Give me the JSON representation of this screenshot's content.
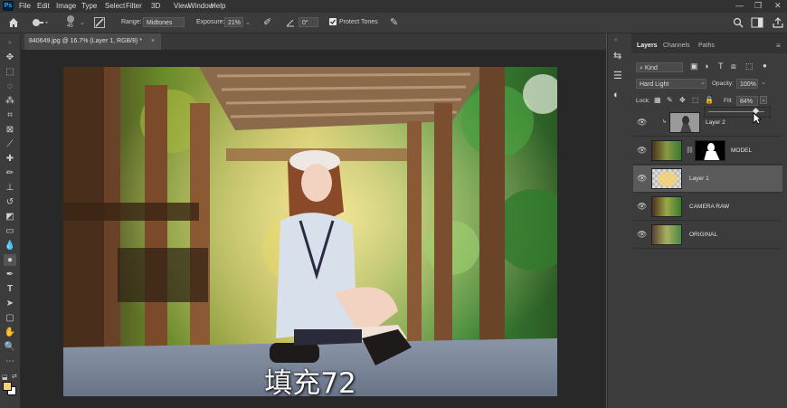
{
  "menubar": {
    "logo": "Ps",
    "items": [
      "File",
      "Edit",
      "Image",
      "Type",
      "Select",
      "Filter",
      "3D",
      "View",
      "Window",
      "Help"
    ],
    "window_controls": [
      "—",
      "❐",
      "✕"
    ]
  },
  "options": {
    "brush_size": "45",
    "range_label": "Range:",
    "range_value": "Midtones",
    "exposure_label": "Exposure:",
    "exposure_value": "21%",
    "angle_value": "0°",
    "protect_tones_label": "Protect Tones",
    "protect_tones_checked": true
  },
  "document": {
    "tab_title": "840649.jpg @ 16.7% (Layer 1, RGB/8) *",
    "tab_close": "×"
  },
  "subtitle": "填充72",
  "panel": {
    "tabs": [
      "Layers",
      "Channels",
      "Paths"
    ],
    "kind_label": "Kind",
    "blend_mode": "Hard Light",
    "opacity_label": "Opacity:",
    "opacity_value": "100%",
    "lock_label": "Lock:",
    "fill_label": "Fill:",
    "fill_value": "84%",
    "fill_slider_fraction": 0.84,
    "layers": [
      {
        "name": "Layer 2",
        "thumb": "gray-person"
      },
      {
        "name": "MODEL",
        "thumb": "photo-with-mask"
      },
      {
        "name": "Layer 1",
        "thumb": "checker-yellow",
        "selected": true
      },
      {
        "name": "CAMERA RAW",
        "thumb": "photo"
      },
      {
        "name": "ORIGINAL",
        "thumb": "photo"
      }
    ]
  },
  "colors": {
    "foreground": "#f3d27a",
    "background": "#ffffff",
    "accent": "#31a8ff"
  }
}
